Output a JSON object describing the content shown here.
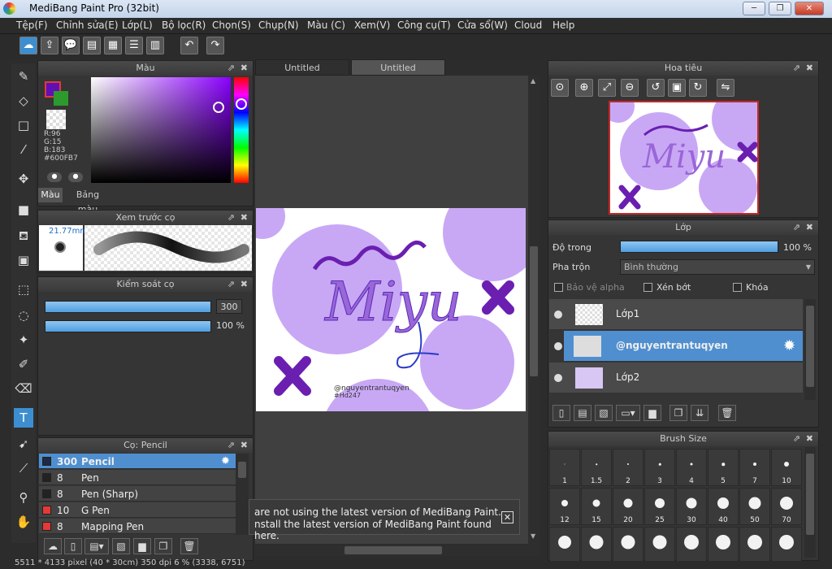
{
  "window": {
    "title": "MediBang Paint Pro (32bit)",
    "minimize": "─",
    "maximize": "❐",
    "close": "✕"
  },
  "menu": [
    "Tệp(F)",
    "Chỉnh sửa(E)",
    "Lớp(L)",
    "Bộ lọc(R)",
    "Chọn(S)",
    "Chụp(N)",
    "Màu (C)",
    "Xem(V)",
    "Công cụ(T)",
    "Cửa sổ(W)",
    "Cloud",
    "Help"
  ],
  "color_panel": {
    "title": "Màu",
    "r": "R:96",
    "g": "G:15",
    "b": "B:183",
    "hex": "#600FB7",
    "tab_color": "Màu",
    "tab_palette": "Bảng màu",
    "primary": "#600fb7",
    "secondary": "#2d9a2d"
  },
  "brush_preview": {
    "title": "Xem trước cọ",
    "size": "21.77mm"
  },
  "brush_control": {
    "title": "Kiểm soát cọ",
    "size_value": "300",
    "opacity_value": "100 %"
  },
  "canvas": {
    "tab1": "Untitled",
    "tab2": "Untitled",
    "art_text": "Miyu",
    "credit": "@nguyentrantuqyen",
    "credit2": "#Hd247"
  },
  "navigator": {
    "title": "Hoa tiêu"
  },
  "layer_panel": {
    "title": "Lớp",
    "opacity_label": "Độ trong",
    "opacity_value": "100 %",
    "blend_label": "Pha trộn",
    "blend_value": "Bình thường",
    "protect_alpha": "Bảo vệ alpha",
    "clipping": "Xén bớt",
    "lock": "Khóa",
    "layers": [
      {
        "name": "Lớp1"
      },
      {
        "name": "@nguyentrantuqyen"
      },
      {
        "name": "Lớp2"
      }
    ]
  },
  "brush_size": {
    "title": "Brush Size",
    "row1": [
      "1",
      "1.5",
      "2",
      "3",
      "4",
      "5",
      "7",
      "10"
    ],
    "row2": [
      "12",
      "15",
      "20",
      "25",
      "30",
      "40",
      "50",
      "70"
    ]
  },
  "brush_list": {
    "title": "Cọ: Pencil",
    "items": [
      {
        "size": "300",
        "name": "Pencil",
        "color": "#1f2a44"
      },
      {
        "size": "8",
        "name": "Pen",
        "color": "#222222"
      },
      {
        "size": "8",
        "name": "Pen (Sharp)",
        "color": "#222222"
      },
      {
        "size": "10",
        "name": "G Pen",
        "color": "#e53935"
      },
      {
        "size": "8",
        "name": "Mapping Pen",
        "color": "#e53935"
      }
    ]
  },
  "notice": {
    "line1": "are not using the latest version of MediBang Paint.",
    "line2": "nstall the latest version of MediBang Paint found here."
  },
  "status": {
    "text": "5511 * 4133 pixel  (40 * 30cm)  350 dpi  6 %  (3338, 6751)"
  }
}
